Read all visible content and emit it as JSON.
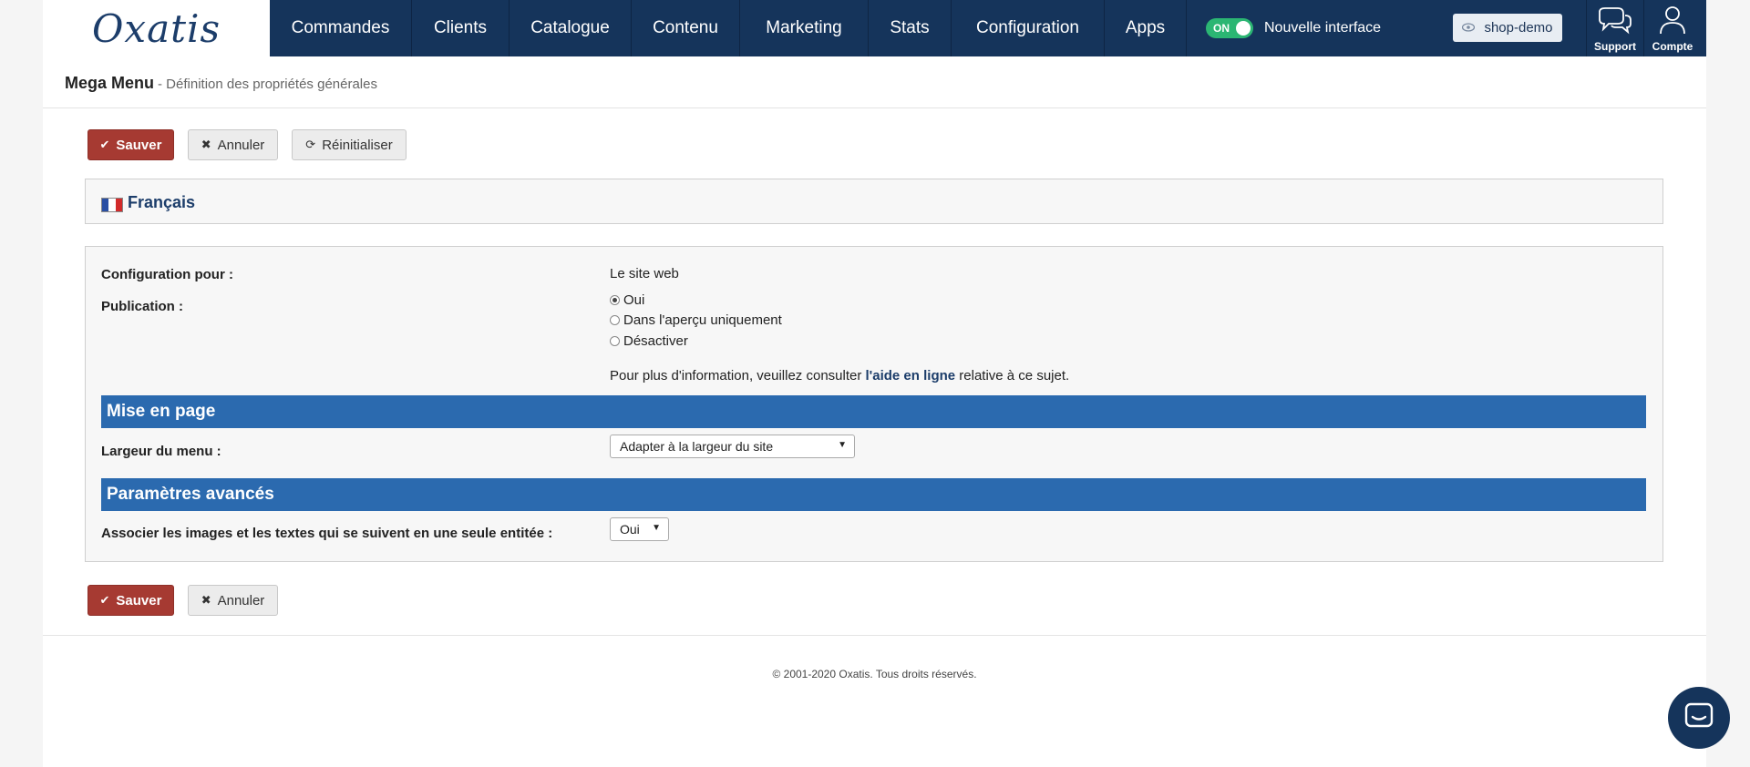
{
  "brand": {
    "logo_text": "Oxatis"
  },
  "nav": {
    "items": [
      {
        "label": "Commandes"
      },
      {
        "label": "Clients"
      },
      {
        "label": "Catalogue"
      },
      {
        "label": "Contenu"
      },
      {
        "label": "Marketing"
      },
      {
        "label": "Stats"
      },
      {
        "label": "Configuration"
      },
      {
        "label": "Apps"
      }
    ],
    "toggle_state": "ON",
    "toggle_label": "Nouvelle interface",
    "shop_label": "shop-demo",
    "support_label": "Support",
    "account_label": "Compte"
  },
  "header": {
    "title": "Mega Menu",
    "subtitle": "- Définition des propriétés générales"
  },
  "toolbar": {
    "save_label": "Sauver",
    "cancel_label": "Annuler",
    "reset_label": "Réinitialiser"
  },
  "language": {
    "label": "Français"
  },
  "form": {
    "config_label": "Configuration pour :",
    "config_value": "Le site web",
    "publication_label": "Publication :",
    "publication_options": [
      "Oui",
      "Dans l'aperçu uniquement",
      "Désactiver"
    ],
    "publication_selected": "Oui",
    "help_prefix": "Pour plus d'information, veuillez consulter ",
    "help_link": "l'aide en ligne",
    "help_suffix": " relative à ce sujet.",
    "section_layout": "Mise en page",
    "menu_width_label": "Largeur du menu :",
    "menu_width_value": "Adapter à la largeur du site",
    "section_advanced": "Paramètres avancés",
    "associate_label": "Associer les images et les textes qui se suivent en une seule entitée :",
    "associate_value": "Oui"
  },
  "footer": {
    "copyright": "© 2001-2020 Oxatis. Tous droits réservés."
  },
  "colors": {
    "nav_bg": "#15345b",
    "save_red": "#a63a32",
    "section_blue": "#2b6aaf",
    "toggle_green": "#2bb673"
  },
  "icons": {
    "save": "check-icon",
    "cancel": "x-icon",
    "reset": "refresh-icon",
    "shop": "eye-icon",
    "support": "chat-bubbles-icon",
    "account": "user-icon",
    "chat": "chat-icon"
  }
}
